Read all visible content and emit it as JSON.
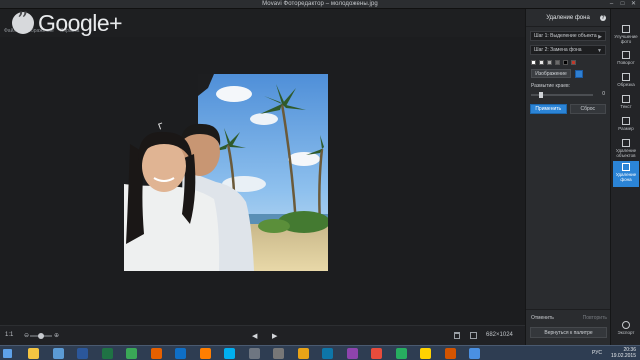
{
  "window": {
    "title": "Movavi Фоторедактор – молодожены.jpg",
    "controls": [
      "‒",
      "□",
      "✕"
    ]
  },
  "overlay": {
    "google_plus_text": "Google+",
    "menu_items": [
      "Файл",
      "Изображение",
      "Справка"
    ]
  },
  "bottombar": {
    "zoom_label": "1:1",
    "zoom_level": 0.5,
    "dimensions": "682×1024"
  },
  "panel": {
    "title": "Удаление фона",
    "help_label": "?",
    "step1": "Шаг 1: Выделение объекта",
    "step2": "Шаг 2: Замена фона",
    "swatch_colors": [
      "#ffffff",
      "#e8e8e8",
      "#a9a9a9",
      "#6b6b6b",
      "#000000",
      "#c0392b"
    ],
    "image_button": "Изображение",
    "blur_label": "Размытие краев:",
    "blur_value": "0",
    "apply_button": "Применить",
    "reset_button": "Сброс",
    "undo": "Отменить",
    "redo": "Повторить",
    "back_button": "Вернуться к палитре"
  },
  "tools": [
    {
      "label": "Улучшение фото"
    },
    {
      "label": "Поворот"
    },
    {
      "label": "Обрезка"
    },
    {
      "label": "Текст"
    },
    {
      "label": "Размер"
    },
    {
      "label": "Удаление объектов"
    },
    {
      "label": "Удаление фона"
    },
    {
      "label": "Экспорт"
    }
  ],
  "taskbar": {
    "language": "РУС",
    "time": "20:36",
    "date": "19.02.2015",
    "icon_colors": [
      "#f4c542",
      "#5b9bd5",
      "#2b579a",
      "#1f7244",
      "#3aa757",
      "#e66000",
      "#0f6fc6",
      "#ff7e00",
      "#00aff0",
      "#6e7681",
      "#777777",
      "#e8a317",
      "#0e76a8",
      "#8e44ad",
      "#e74c3c",
      "#27ae60",
      "#ffd200",
      "#d35400",
      "#4a90e2"
    ]
  }
}
